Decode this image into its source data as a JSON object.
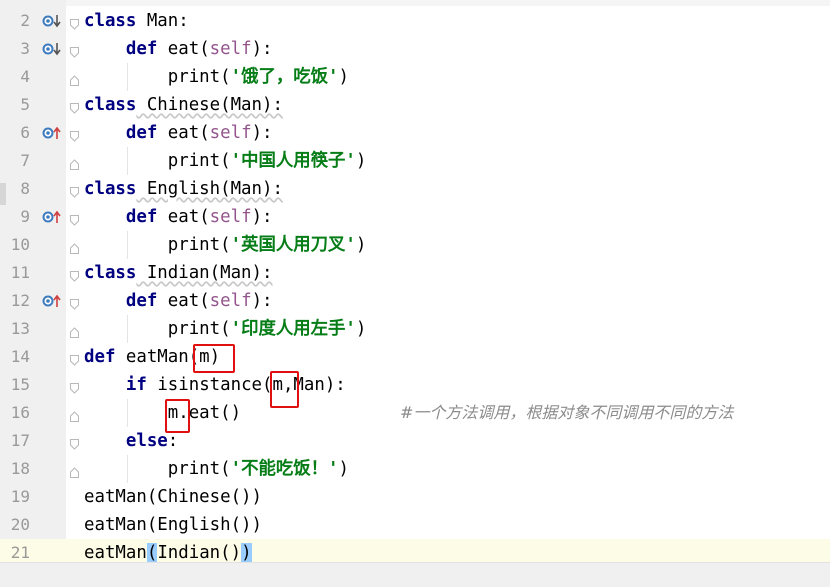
{
  "editor": {
    "comment": "#一个方法调用，根据对象不同调用不同的方法",
    "lines": [
      {
        "num": "2",
        "icon": "override-down"
      },
      {
        "num": "3",
        "icon": "override-down"
      },
      {
        "num": "4",
        "icon": ""
      },
      {
        "num": "5",
        "icon": ""
      },
      {
        "num": "6",
        "icon": "override-up"
      },
      {
        "num": "7",
        "icon": ""
      },
      {
        "num": "8",
        "icon": ""
      },
      {
        "num": "9",
        "icon": "override-up"
      },
      {
        "num": "10",
        "icon": ""
      },
      {
        "num": "11",
        "icon": ""
      },
      {
        "num": "12",
        "icon": "override-up"
      },
      {
        "num": "13",
        "icon": ""
      },
      {
        "num": "14",
        "icon": ""
      },
      {
        "num": "15",
        "icon": ""
      },
      {
        "num": "16",
        "icon": ""
      },
      {
        "num": "17",
        "icon": ""
      },
      {
        "num": "18",
        "icon": ""
      },
      {
        "num": "19",
        "icon": ""
      },
      {
        "num": "20",
        "icon": ""
      },
      {
        "num": "21",
        "icon": ""
      }
    ],
    "tokens": {
      "l2": [
        {
          "t": "class",
          "c": "kw"
        },
        {
          "t": " Man:"
        }
      ],
      "l3": [
        {
          "t": "    "
        },
        {
          "t": "def",
          "c": "kw"
        },
        {
          "t": " eat("
        },
        {
          "t": "self",
          "c": "sf"
        },
        {
          "t": "):"
        }
      ],
      "l4": [
        {
          "t": "        print("
        },
        {
          "t": "'饿了，吃饭'",
          "c": "st"
        },
        {
          "t": ")"
        }
      ],
      "l5": [
        {
          "t": "class",
          "c": "kw"
        },
        {
          "t": " Chinese(Man):"
        }
      ],
      "l6": [
        {
          "t": "    "
        },
        {
          "t": "def",
          "c": "kw"
        },
        {
          "t": " eat("
        },
        {
          "t": "self",
          "c": "sf"
        },
        {
          "t": "):"
        }
      ],
      "l7": [
        {
          "t": "        print("
        },
        {
          "t": "'中国人用筷子'",
          "c": "st"
        },
        {
          "t": ")"
        }
      ],
      "l8": [
        {
          "t": "class",
          "c": "kw"
        },
        {
          "t": " English(Man):"
        }
      ],
      "l9": [
        {
          "t": "    "
        },
        {
          "t": "def",
          "c": "kw"
        },
        {
          "t": " eat("
        },
        {
          "t": "self",
          "c": "sf"
        },
        {
          "t": "):"
        }
      ],
      "l10": [
        {
          "t": "        print("
        },
        {
          "t": "'英国人用刀叉'",
          "c": "st"
        },
        {
          "t": ")"
        }
      ],
      "l11": [
        {
          "t": "class",
          "c": "kw"
        },
        {
          "t": " Indian(Man):"
        }
      ],
      "l12": [
        {
          "t": "    "
        },
        {
          "t": "def",
          "c": "kw"
        },
        {
          "t": " eat("
        },
        {
          "t": "self",
          "c": "sf"
        },
        {
          "t": "):"
        }
      ],
      "l13": [
        {
          "t": "        print("
        },
        {
          "t": "'印度人用左手'",
          "c": "st"
        },
        {
          "t": ")"
        }
      ],
      "l14": [
        {
          "t": "def",
          "c": "kw"
        },
        {
          "t": " eatMan(m)"
        }
      ],
      "l15": [
        {
          "t": "    "
        },
        {
          "t": "if",
          "c": "kw"
        },
        {
          "t": " isinstance(m,Man):"
        }
      ],
      "l16": [
        {
          "t": "        m.eat()"
        }
      ],
      "l17": [
        {
          "t": "    "
        },
        {
          "t": "else",
          "c": "kw"
        },
        {
          "t": ":"
        }
      ],
      "l18": [
        {
          "t": "        print("
        },
        {
          "t": "'不能吃饭！'",
          "c": "st"
        },
        {
          "t": ")"
        }
      ],
      "l19": [
        {
          "t": "eatMan(Chinese())"
        }
      ],
      "l20": [
        {
          "t": "eatMan(English())"
        }
      ],
      "l21": [
        {
          "t": "eatMan"
        },
        {
          "t": "(",
          "c": "brace"
        },
        {
          "t": "Indian()"
        },
        {
          "t": ")",
          "c": "brace"
        }
      ]
    }
  },
  "colors": {
    "keyword": "#000080",
    "self": "#94558d",
    "string": "#067d17",
    "comment": "#8c8c8c",
    "highlight_box": "#e01010",
    "current_line": "#fdfce6",
    "override_icon": "#3d7bbf"
  }
}
